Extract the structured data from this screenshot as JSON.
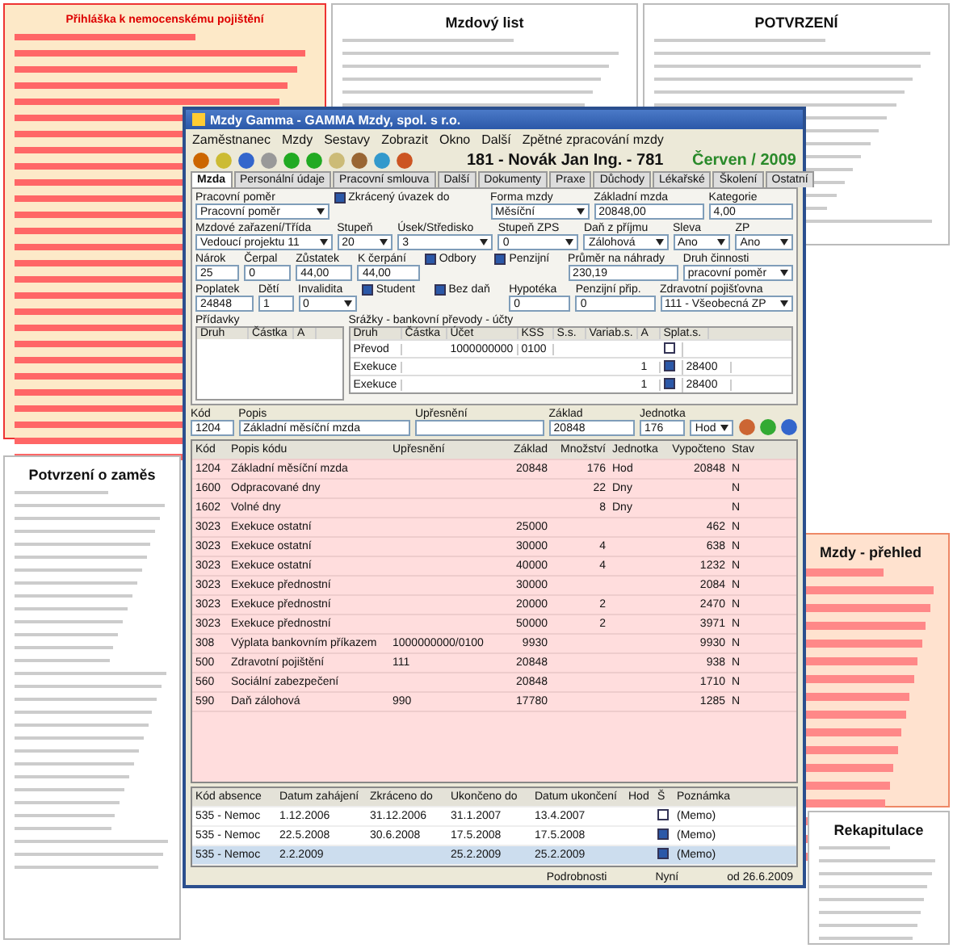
{
  "documents": [
    {
      "kind": "red-form",
      "title": "Přihláška k nemocenskému pojištění"
    },
    {
      "kind": "paper",
      "title": "Mzdový list"
    },
    {
      "kind": "paper",
      "title": "POTVRZENÍ"
    },
    {
      "kind": "paper",
      "title": "Potvrzení o zaměs"
    },
    {
      "kind": "orange-app",
      "title": "Mzdy - přehled"
    },
    {
      "kind": "table",
      "title": "Rekapitulace"
    }
  ],
  "window": {
    "title": "Mzdy Gamma - GAMMA Mzdy, spol. s r.o.",
    "menu": [
      "Zaměstnanec",
      "Mzdy",
      "Sestavy",
      "Zobrazit",
      "Okno",
      "Další",
      "Zpětné zpracování mzdy"
    ],
    "employee": "181 - Novák Jan Ing. - 781",
    "period": "Červen / 2009",
    "tabs": [
      {
        "label": "Mzda",
        "selected": true
      },
      {
        "label": "Personální údaje",
        "selected": false
      },
      {
        "label": "Pracovní smlouva",
        "selected": false
      },
      {
        "label": "Další",
        "selected": false
      },
      {
        "label": "Dokumenty",
        "selected": false
      },
      {
        "label": "Praxe",
        "selected": false
      },
      {
        "label": "Důchody",
        "selected": false
      },
      {
        "label": "Lékařské",
        "selected": false
      },
      {
        "label": "Školení",
        "selected": false
      },
      {
        "label": "Ostatní",
        "selected": false
      }
    ],
    "form_rows": [
      [
        {
          "kind": "select",
          "label": "Pracovní poměr",
          "value": "Pracovní poměr"
        },
        {
          "kind": "check",
          "label": "Zkrácený úvazek do",
          "checked": true
        },
        {
          "kind": "select",
          "label": "Forma mzdy",
          "value": "Měsíční"
        },
        {
          "kind": "text",
          "label": "Základní mzda",
          "value": "20848,00"
        },
        {
          "kind": "text",
          "label": "Kategorie",
          "value": "4,00"
        }
      ],
      [
        {
          "kind": "select",
          "label": "Mzdové zařazení/Třída",
          "value": "Vedoucí projektu 11"
        },
        {
          "kind": "select",
          "label": "Stupeň",
          "value": "20"
        },
        {
          "kind": "select",
          "label": "Úsek/Středisko",
          "value": "3"
        },
        {
          "kind": "select",
          "label": "Stupeň ZPS",
          "value": "0"
        },
        {
          "kind": "select",
          "label": "Daň z příjmu",
          "value": "Zálohová"
        },
        {
          "kind": "select",
          "label": "Sleva",
          "value": "Ano"
        },
        {
          "kind": "select",
          "label": "ZP",
          "value": "Ano"
        }
      ],
      [
        {
          "kind": "text",
          "label": "Nárok",
          "value": "25"
        },
        {
          "kind": "text",
          "label": "Čerpal",
          "value": "0"
        },
        {
          "kind": "text",
          "label": "Zůstatek",
          "value": "44,00"
        },
        {
          "kind": "text",
          "label": "K čerpání",
          "value": "44,00"
        },
        {
          "kind": "check",
          "label": "Odbory",
          "checked": true
        },
        {
          "kind": "check",
          "label": "Penzijní",
          "checked": true
        },
        {
          "kind": "text",
          "label": "Průměr na náhrady",
          "value": "230,19"
        },
        {
          "kind": "select",
          "label": "Druh činnosti",
          "value": "pracovní poměr"
        }
      ],
      [
        {
          "kind": "text",
          "label": "Poplatek",
          "value": "24848"
        },
        {
          "kind": "text",
          "label": "Dětí",
          "value": "1"
        },
        {
          "kind": "select",
          "label": "Invalidita",
          "value": "0"
        },
        {
          "kind": "check",
          "label": "Student",
          "checked": true
        },
        {
          "kind": "check",
          "label": "Bez daň",
          "checked": true
        },
        {
          "kind": "text",
          "label": "Hypotéka",
          "value": "0"
        },
        {
          "kind": "text",
          "label": "Penzijní přip.",
          "value": "0"
        },
        {
          "kind": "select",
          "label": "Zdravotní pojišťovna",
          "value": "111 - Všeobecná ZP"
        }
      ]
    ],
    "allowances": {
      "title": "Přídavky",
      "columns": [
        "Druh",
        "Částka",
        "A"
      ]
    },
    "deductions": {
      "title": "Srážky - bankovní převody - účty",
      "columns": [
        "Druh",
        "Částka",
        "Účet",
        "KSS",
        "S.s.",
        "Variab.s.",
        "A",
        "Splat.s."
      ],
      "rows": [
        {
          "cells": [
            "Převod",
            "",
            "1000000000",
            "0100",
            "",
            "",
            ""
          ],
          "checked": false
        },
        {
          "cells": [
            "Exekuce",
            "",
            "",
            "",
            "",
            "",
            "1"
          ],
          "checked": true,
          "due": "28400"
        },
        {
          "cells": [
            "Exekuce",
            "",
            "",
            "",
            "",
            "",
            "1"
          ],
          "checked": true,
          "due": "28400"
        }
      ]
    },
    "entry": {
      "labels": [
        "Kód",
        "Popis",
        "Upřesnění",
        "Základ",
        "Jednotka"
      ],
      "code": "1204",
      "description": "Základní měsíční mzda",
      "base": "20848",
      "amount": "176",
      "unit": "Hod"
    },
    "pay_table": {
      "columns": [
        "Kód",
        "Popis kódu",
        "Upřesnění",
        "Základ",
        "Množství",
        "Jednotka",
        "Vypočteno",
        "Stav"
      ],
      "rows": [
        [
          "1204",
          "Základní měsíční mzda",
          "",
          "20848",
          "176",
          "Hod",
          "20848",
          "N"
        ],
        [
          "1600",
          "Odpracované dny",
          "",
          "",
          "22",
          "Dny",
          "",
          "N"
        ],
        [
          "1602",
          "Volné dny",
          "",
          "",
          "8",
          "Dny",
          "",
          "N"
        ],
        [
          "3023",
          "Exekuce ostatní",
          "",
          "25000",
          "",
          "",
          "462",
          "N"
        ],
        [
          "3023",
          "Exekuce ostatní",
          "",
          "30000",
          "4",
          "",
          "638",
          "N"
        ],
        [
          "3023",
          "Exekuce ostatní",
          "",
          "40000",
          "4",
          "",
          "1232",
          "N"
        ],
        [
          "3023",
          "Exekuce přednostní",
          "",
          "30000",
          "",
          "",
          "2084",
          "N"
        ],
        [
          "3023",
          "Exekuce přednostní",
          "",
          "20000",
          "2",
          "",
          "2470",
          "N"
        ],
        [
          "3023",
          "Exekuce přednostní",
          "",
          "50000",
          "2",
          "",
          "3971",
          "N"
        ],
        [
          "308",
          "Výplata bankovním příkazem",
          "1000000000/0100",
          "9930",
          "",
          "",
          "9930",
          "N"
        ],
        [
          "500",
          "Zdravotní pojištění",
          "111",
          "20848",
          "",
          "",
          "938",
          "N"
        ],
        [
          "560",
          "Sociální zabezpečení",
          "",
          "20848",
          "",
          "",
          "1710",
          "N"
        ],
        [
          "590",
          "Daň zálohová",
          "990",
          "17780",
          "",
          "",
          "1285",
          "N"
        ]
      ]
    },
    "absence_table": {
      "columns": [
        "Kód absence",
        "Datum zahájení",
        "Zkráceno do",
        "Ukončeno do",
        "Datum ukončení",
        "Hod",
        "Š",
        "Poznámka"
      ],
      "rows": [
        {
          "cells": [
            "535 - Nemoc",
            "1.12.2006",
            "31.12.2006",
            "31.1.2007",
            "13.4.2007",
            ""
          ],
          "checked": false,
          "note": "(Memo)",
          "selected": false
        },
        {
          "cells": [
            "535 - Nemoc",
            "22.5.2008",
            "30.6.2008",
            "17.5.2008",
            "17.5.2008",
            ""
          ],
          "checked": true,
          "note": "(Memo)",
          "selected": false
        },
        {
          "cells": [
            "535 - Nemoc",
            "2.2.2009",
            "",
            "25.2.2009",
            "25.2.2009",
            ""
          ],
          "checked": true,
          "note": "(Memo)",
          "selected": true
        }
      ]
    },
    "status_bar": [
      "Podrobnosti",
      "Nyní",
      "od 26.6.2009"
    ]
  }
}
